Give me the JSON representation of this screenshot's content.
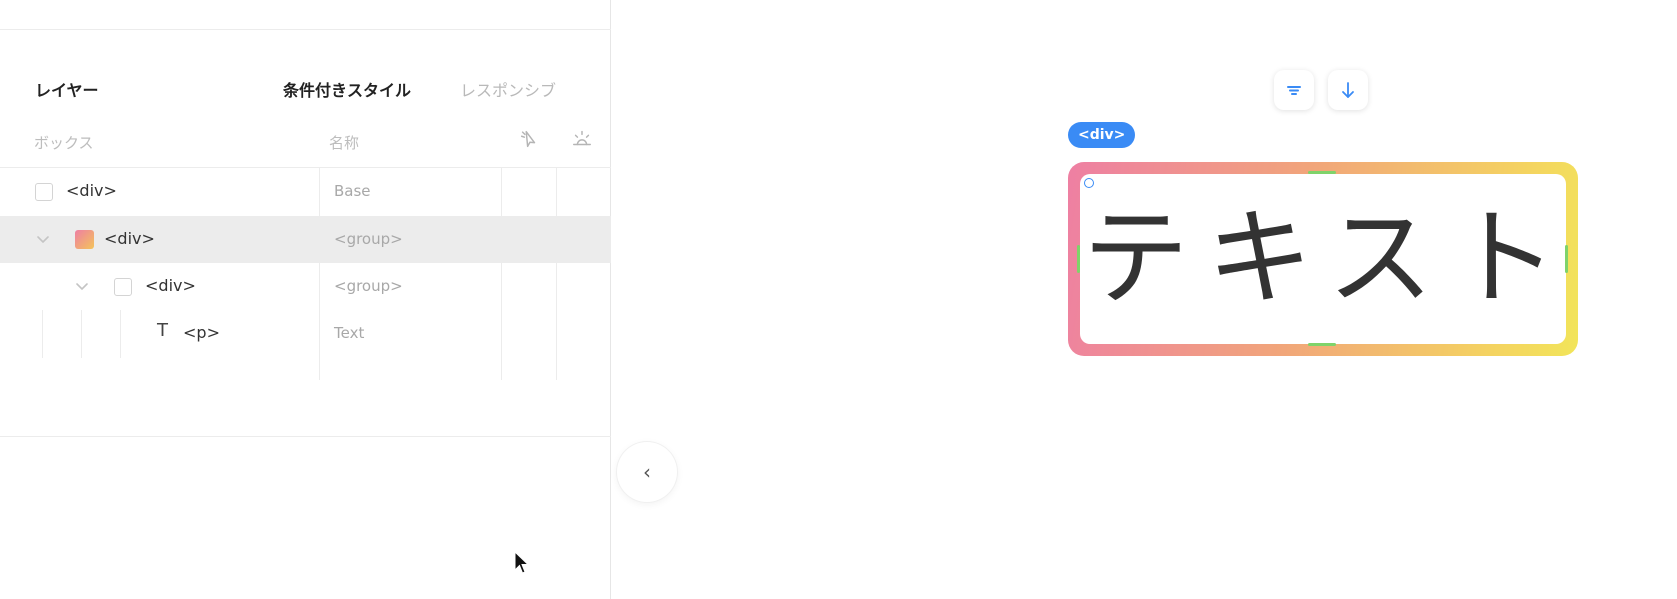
{
  "panel": {
    "tabs": [
      {
        "label": "レイヤー",
        "active": true
      },
      {
        "label": "条件付きスタイル",
        "active": true
      },
      {
        "label": "レスポンシブ",
        "active": false
      }
    ],
    "columns": {
      "box": "ボックス",
      "name": "名称"
    },
    "column_icons": [
      "cursor-pointer-icon",
      "bulk-sparkle-icon"
    ],
    "rows": [
      {
        "label": "<div>",
        "name": "Base",
        "icon": "checkbox",
        "expanded": null
      },
      {
        "label": "<div>",
        "name": "<group>",
        "icon": "gradient-swatch",
        "expanded": true,
        "selected": true
      },
      {
        "label": "<div>",
        "name": "<group>",
        "icon": "checkbox",
        "expanded": true
      },
      {
        "label": "<p>",
        "name": "Text",
        "icon": "text-T-icon",
        "expanded": null
      }
    ],
    "text_glyph": "T"
  },
  "collapse_button": {
    "glyph": "‹"
  },
  "canvas": {
    "toolbar_icons": [
      "align-icon",
      "arrow-down-icon"
    ],
    "selected_tag": "<div>",
    "content_text": "テキスト",
    "gradient_colors": [
      "#ee7fa3",
      "#f1a57a",
      "#f4d460",
      "#f2e55a"
    ],
    "accent": "#3a8bf5",
    "handle_color": "#7fd36a"
  }
}
